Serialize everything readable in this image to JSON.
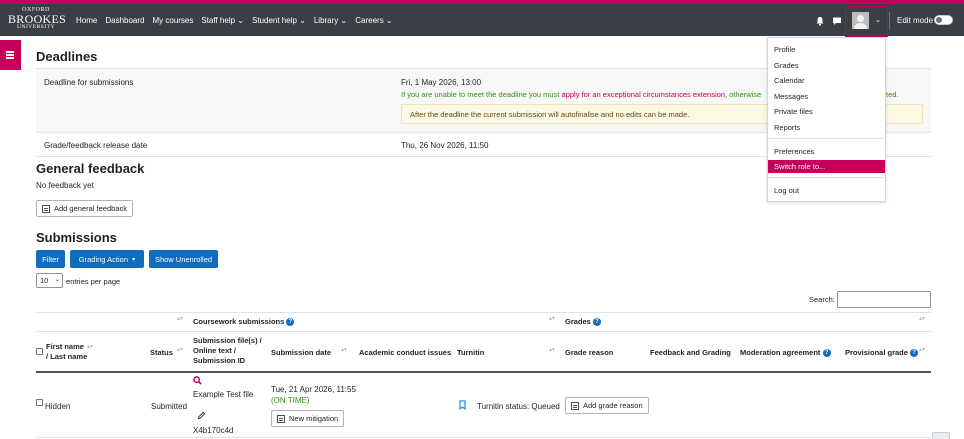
{
  "logo": {
    "line1": "OXFORD",
    "line2": "BROOKES",
    "line3": "UNIVERSITY"
  },
  "nav": {
    "links": [
      "Home",
      "Dashboard",
      "My courses",
      "Staff help ⌄",
      "Student help ⌄",
      "Library ⌄",
      "Careers ⌄"
    ],
    "edit_mode": "Edit mode",
    "avatar_caret": "⌄"
  },
  "user_menu": {
    "items": [
      "Profile",
      "Grades",
      "Calendar",
      "Messages",
      "Private files",
      "Reports"
    ],
    "preferences": "Preferences",
    "switch_role": "Switch role to...",
    "logout": "Log out"
  },
  "deadlines": {
    "heading": "Deadlines",
    "submissions_label": "Deadline for submissions",
    "submissions_date": "Fri, 1 May 2026, 13:00",
    "extension_prefix": "If you are unable to meet the deadline you must ",
    "extension_link": "apply for an exceptional circumstances extension",
    "extension_suffix": ", otherwise",
    "extension_tail": "ted.",
    "notice": "After the deadline the current submission will autofinalise and no edits can be made.",
    "release_label": "Grade/feedback release date",
    "release_date": "Thu, 26 Nov 2026, 11:50"
  },
  "general_feedback": {
    "heading": "General feedback",
    "empty_text": "No feedback yet",
    "add_button": "Add general feedback"
  },
  "submissions": {
    "heading": "Submissions",
    "filter_button": "Filter",
    "grading_action_button": "Grading Action",
    "grading_action_caret": "▾",
    "show_unenrolled_button": "Show Unenrolled",
    "entries_value": "10",
    "entries_caret": "⌄",
    "entries_label": "entries per page",
    "search_label": "Search:",
    "search_value": "",
    "group_headers": {
      "coursework": "Coursework submissions",
      "grades": "Grades"
    },
    "columns": {
      "name_line1": "First name",
      "name_line2": "/ Last name",
      "status": "Status",
      "files_line1": "Submission file(s) /",
      "files_line2": "Online text /",
      "files_line3": "Submission ID",
      "date": "Submission date",
      "conduct": "Academic conduct issues",
      "turnitin": "Turnitin",
      "grade_reason": "Grade reason",
      "feedback": "Feedback and Grading",
      "moderation": "Moderation agreement",
      "provisional": "Provisional grade"
    },
    "help_glyph": "?",
    "sort_glyph": "▴▾",
    "rows": [
      {
        "name": "Hidden",
        "status": "Submitted",
        "file_name": "Example Test file",
        "submission_id": "X4b170c4d",
        "date": "Tue, 21 Apr 2026, 11:55",
        "timing": "(ON TIME)",
        "mitigation_button": "New mitigation",
        "turnitin_status": "Turnitin status: Queued",
        "grade_reason_button": "Add grade reason"
      }
    ]
  },
  "colors": {
    "brand": "#c4005a",
    "nav_bg": "#3a3f45",
    "primary": "#0f6cbf",
    "success": "#3b8c1f"
  },
  "icons": [
    "bell-icon",
    "chat-icon",
    "avatar",
    "hamburger-icon",
    "magnifier-icon",
    "pencil-icon",
    "turnitin-icon",
    "question-icon",
    "sort-icon"
  ]
}
